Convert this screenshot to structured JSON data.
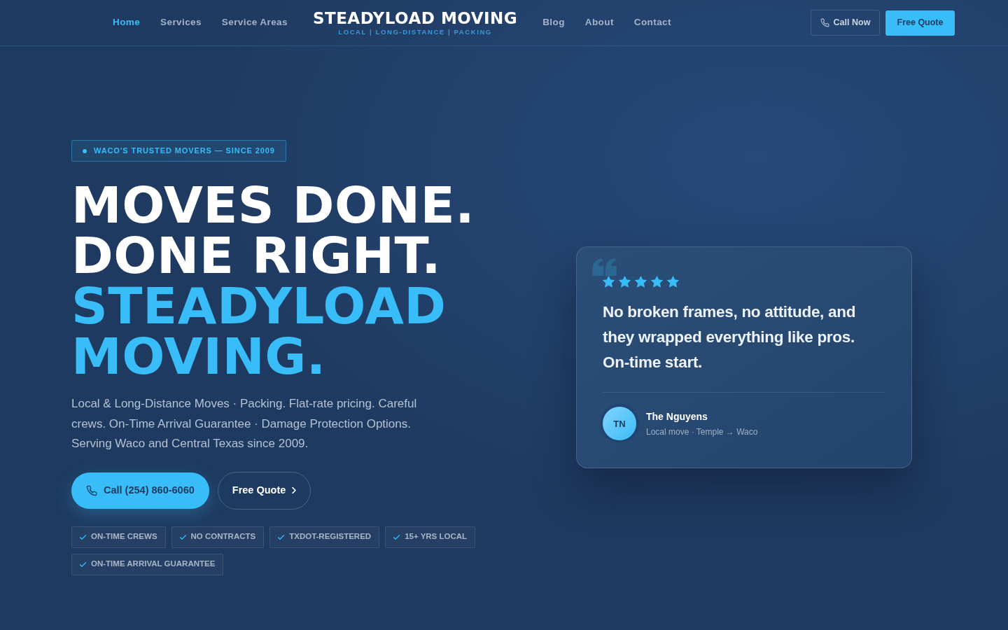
{
  "nav": {
    "links_left": [
      {
        "label": "Home",
        "selected": true
      },
      {
        "label": "Services",
        "selected": false
      },
      {
        "label": "Service Areas",
        "selected": false
      }
    ],
    "logo": {
      "name": "STEADYLOAD MOVING",
      "tagline": "LOCAL | LONG-DISTANCE | PACKING"
    },
    "links_right": [
      {
        "label": "Blog",
        "selected": false
      },
      {
        "label": "About",
        "selected": false
      },
      {
        "label": "Contact",
        "selected": false
      }
    ],
    "call_button": "Call Now",
    "quote_button": "Free Quote"
  },
  "hero": {
    "eyebrow": "WACO'S TRUSTED MOVERS — SINCE 2009",
    "headline": [
      {
        "text": "MOVES DONE.",
        "kind": "plain"
      },
      {
        "text": "DONE RIGHT.",
        "kind": "plain"
      },
      {
        "text": "STEADYLOAD",
        "kind": "accent"
      },
      {
        "text": "MOVING.",
        "kind": "accent"
      }
    ],
    "description": "Local & Long-Distance Moves · Packing. Flat-rate pricing. Careful crews. On-Time Arrival Guarantee · Damage Protection Options. Serving Waco and Central Texas since 2009.",
    "primary_button": "Call (254) 860-6060",
    "secondary_button": "Free Quote",
    "badges": [
      "ON-TIME CREWS",
      "NO CONTRACTS",
      "TXDOT-REGISTERED",
      "15+ YRS LOCAL",
      "ON-TIME ARRIVAL GUARANTEE"
    ]
  },
  "review": {
    "stars": 5,
    "quote": "No broken frames, no attitude, and they wrapped everything like pros. On-time start.",
    "initials": "TN",
    "name": "The Nguyens",
    "detail": "Local move · Temple → Waco"
  }
}
